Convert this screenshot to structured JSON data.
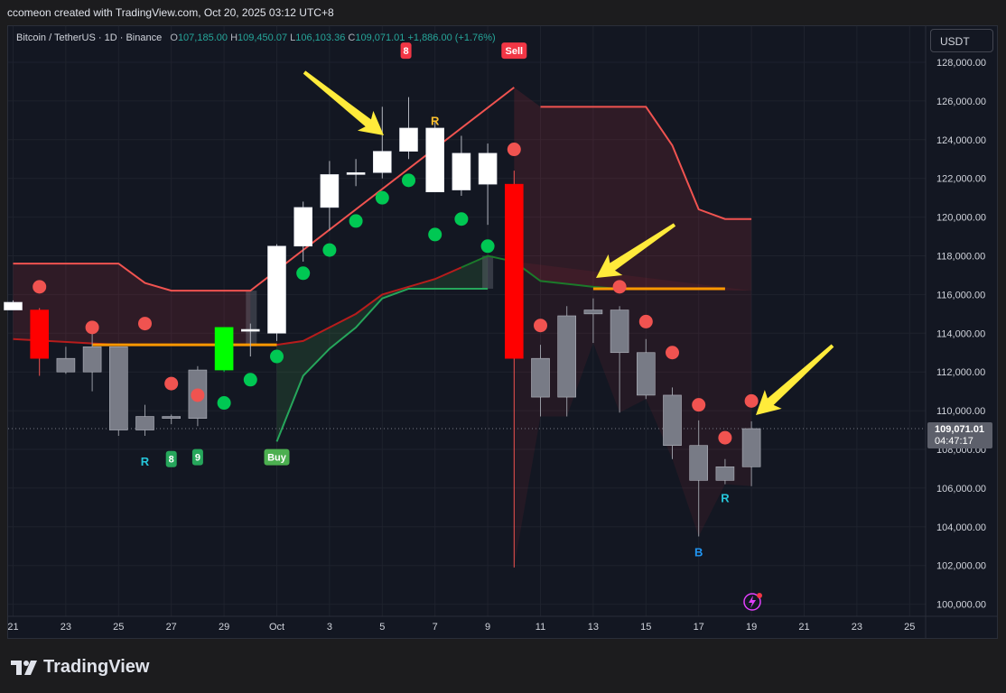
{
  "header": {
    "snapshot_text": "ccomeon created with TradingView.com, Oct 20, 2025 03:12 UTC+8"
  },
  "legend": {
    "symbol": "Bitcoin / TetherUS · 1D · Binance",
    "open_label": "O",
    "open": "107,185.00",
    "high_label": "H",
    "high": "109,450.07",
    "low_label": "L",
    "low": "106,103.36",
    "close_label": "C",
    "close": "109,071.01",
    "change": "+1,886.00 (+1.76%)"
  },
  "currency_button": "USDT",
  "footer": {
    "brand": "TradingView"
  },
  "colors": {
    "background": "#131722",
    "grid": "#1e222d",
    "bull_body": "#ffffff",
    "bear_body_red": "#ff0000",
    "bear_body_gray": "#787b86",
    "buy_green": "#00ff00",
    "sell_label": "#f23645",
    "buy_label": "#4caf50",
    "dot_red": "#f05350",
    "dot_green": "#00c853",
    "arrow": "#ffeb3b"
  },
  "chart_data": {
    "type": "candlestick",
    "y_axis": {
      "range": [
        99500,
        129000
      ],
      "ticks": [
        "100,000.00",
        "102,000.00",
        "104,000.00",
        "106,000.00",
        "108,000.00",
        "110,000.00",
        "112,000.00",
        "114,000.00",
        "116,000.00",
        "118,000.00",
        "120,000.00",
        "122,000.00",
        "124,000.00",
        "126,000.00",
        "128,000.00"
      ],
      "tick_values": [
        100000,
        102000,
        104000,
        106000,
        108000,
        110000,
        112000,
        114000,
        116000,
        118000,
        120000,
        122000,
        124000,
        126000,
        128000
      ]
    },
    "x_axis": {
      "labels": [
        "21",
        "23",
        "25",
        "27",
        "29",
        "Oct",
        "3",
        "5",
        "7",
        "9",
        "11",
        "13",
        "15",
        "17",
        "19",
        "21",
        "23",
        "25"
      ],
      "label_day_index": [
        0,
        2,
        4,
        6,
        8,
        10,
        12,
        14,
        16,
        18,
        20,
        22,
        24,
        26,
        28,
        30,
        32,
        34
      ]
    },
    "candles": [
      {
        "d": 0,
        "o": 115600,
        "h": 115700,
        "l": 115200,
        "c": 115200,
        "style": "bull"
      },
      {
        "d": 1,
        "o": 115200,
        "h": 115300,
        "l": 111800,
        "c": 112700,
        "style": "red"
      },
      {
        "d": 2,
        "o": 112700,
        "h": 113300,
        "l": 111900,
        "c": 112000,
        "style": "gray"
      },
      {
        "d": 3,
        "o": 112000,
        "h": 114000,
        "l": 111000,
        "c": 113300,
        "style": "gray"
      },
      {
        "d": 4,
        "o": 113300,
        "h": 113300,
        "l": 108700,
        "c": 109000,
        "style": "gray"
      },
      {
        "d": 5,
        "o": 109700,
        "h": 110300,
        "l": 108700,
        "c": 109000,
        "style": "gray"
      },
      {
        "d": 6,
        "o": 109700,
        "h": 109800,
        "l": 109300,
        "c": 109600,
        "style": "gray"
      },
      {
        "d": 7,
        "o": 109600,
        "h": 112300,
        "l": 109200,
        "c": 112100,
        "style": "gray"
      },
      {
        "d": 8,
        "o": 112100,
        "h": 114300,
        "l": 112000,
        "c": 114300,
        "style": "green"
      },
      {
        "d": 9,
        "o": 114100,
        "h": 114500,
        "l": 112800,
        "c": 114200,
        "style": "bull"
      },
      {
        "d": 10,
        "o": 114000,
        "h": 118600,
        "l": 113600,
        "c": 118500,
        "style": "bull"
      },
      {
        "d": 11,
        "o": 118500,
        "h": 120800,
        "l": 117700,
        "c": 120500,
        "style": "bull"
      },
      {
        "d": 12,
        "o": 120500,
        "h": 122900,
        "l": 119300,
        "c": 122200,
        "style": "bull"
      },
      {
        "d": 13,
        "o": 122200,
        "h": 123000,
        "l": 121600,
        "c": 122300,
        "style": "bull"
      },
      {
        "d": 14,
        "o": 122300,
        "h": 125700,
        "l": 122000,
        "c": 123400,
        "style": "bull"
      },
      {
        "d": 15,
        "o": 123400,
        "h": 126200,
        "l": 123000,
        "c": 124600,
        "style": "bull"
      },
      {
        "d": 16,
        "o": 124600,
        "h": 125000,
        "l": 121300,
        "c": 121300,
        "style": "bull"
      },
      {
        "d": 17,
        "o": 121400,
        "h": 124200,
        "l": 121100,
        "c": 123300,
        "style": "bull"
      },
      {
        "d": 18,
        "o": 123300,
        "h": 123800,
        "l": 119600,
        "c": 121700,
        "style": "bull"
      },
      {
        "d": 19,
        "o": 121700,
        "h": 122400,
        "l": 101900,
        "c": 112700,
        "style": "red"
      },
      {
        "d": 20,
        "o": 110700,
        "h": 113400,
        "l": 109700,
        "c": 112700,
        "style": "gray"
      },
      {
        "d": 21,
        "o": 110700,
        "h": 115400,
        "l": 109700,
        "c": 114900,
        "style": "gray"
      },
      {
        "d": 22,
        "o": 115000,
        "h": 115800,
        "l": 113500,
        "c": 115200,
        "style": "gray"
      },
      {
        "d": 23,
        "o": 115200,
        "h": 115400,
        "l": 109900,
        "c": 113000,
        "style": "gray"
      },
      {
        "d": 24,
        "o": 113000,
        "h": 113700,
        "l": 110600,
        "c": 110800,
        "style": "gray"
      },
      {
        "d": 25,
        "o": 110800,
        "h": 111200,
        "l": 107500,
        "c": 108200,
        "style": "gray"
      },
      {
        "d": 26,
        "o": 108200,
        "h": 109500,
        "l": 103500,
        "c": 106400,
        "style": "gray"
      },
      {
        "d": 27,
        "o": 106400,
        "h": 107500,
        "l": 106200,
        "c": 107100,
        "style": "gray"
      },
      {
        "d": 28,
        "o": 107100,
        "h": 109450,
        "l": 106100,
        "c": 109071,
        "style": "gray"
      }
    ],
    "dots": [
      {
        "d": 1,
        "v": 116400,
        "c": "red"
      },
      {
        "d": 3,
        "v": 114300,
        "c": "red"
      },
      {
        "d": 5,
        "v": 114500,
        "c": "red"
      },
      {
        "d": 6,
        "v": 111400,
        "c": "red"
      },
      {
        "d": 7,
        "v": 110800,
        "c": "red"
      },
      {
        "d": 8,
        "v": 110400,
        "c": "green"
      },
      {
        "d": 9,
        "v": 111600,
        "c": "green"
      },
      {
        "d": 10,
        "v": 112800,
        "c": "green"
      },
      {
        "d": 11,
        "v": 117100,
        "c": "green"
      },
      {
        "d": 12,
        "v": 118300,
        "c": "green"
      },
      {
        "d": 13,
        "v": 119800,
        "c": "green"
      },
      {
        "d": 14,
        "v": 121000,
        "c": "green"
      },
      {
        "d": 15,
        "v": 121900,
        "c": "green"
      },
      {
        "d": 16,
        "v": 119100,
        "c": "green"
      },
      {
        "d": 17,
        "v": 119900,
        "c": "green"
      },
      {
        "d": 18,
        "v": 118500,
        "c": "green"
      },
      {
        "d": 19,
        "v": 123500,
        "c": "red"
      },
      {
        "d": 20,
        "v": 114400,
        "c": "red"
      },
      {
        "d": 23,
        "v": 116400,
        "c": "red"
      },
      {
        "d": 24,
        "v": 114600,
        "c": "red"
      },
      {
        "d": 25,
        "v": 113000,
        "c": "red"
      },
      {
        "d": 26,
        "v": 110300,
        "c": "red"
      },
      {
        "d": 27,
        "v": 108600,
        "c": "red"
      },
      {
        "d": 28,
        "v": 110500,
        "c": "red"
      }
    ],
    "upper_band": [
      [
        0,
        117600
      ],
      [
        4,
        117600
      ],
      [
        5,
        116600
      ],
      [
        6,
        116200
      ],
      [
        9,
        116200
      ],
      [
        19,
        126700
      ],
      [
        20,
        125700
      ],
      [
        24,
        125700
      ],
      [
        25,
        123700
      ],
      [
        26,
        120400
      ],
      [
        27,
        119900
      ],
      [
        28,
        119900
      ]
    ],
    "lower_band": [
      [
        10,
        108400
      ],
      [
        11,
        111800
      ],
      [
        12,
        113200
      ],
      [
        13,
        114300
      ],
      [
        14,
        115800
      ],
      [
        15,
        116300
      ],
      [
        18,
        116300
      ]
    ],
    "baseline_red": [
      [
        0,
        113700
      ],
      [
        4,
        113400
      ],
      [
        9,
        113400
      ],
      [
        10,
        113400
      ],
      [
        11,
        113600
      ],
      [
        12,
        114300
      ],
      [
        13,
        115000
      ],
      [
        14,
        116000
      ],
      [
        15,
        116400
      ],
      [
        16,
        116800
      ],
      [
        17,
        117400
      ],
      [
        18,
        118000
      ],
      [
        19,
        117700
      ],
      [
        20,
        116700
      ],
      [
        22,
        116400
      ],
      [
        23,
        116300
      ],
      [
        28,
        116200
      ]
    ],
    "orange_line_1": [
      [
        3,
        113400
      ],
      [
        10,
        113400
      ]
    ],
    "orange_line_2": [
      [
        22,
        116300
      ],
      [
        27,
        116300
      ]
    ],
    "price_labels": [
      {
        "d": 14.9,
        "v": 128600,
        "text": "8",
        "kind": "red-tag"
      },
      {
        "d": 19,
        "v": 128600,
        "text": "Sell",
        "kind": "red-tag"
      },
      {
        "d": 16,
        "v": 125000,
        "text": "R",
        "kind": "yellow-text"
      },
      {
        "d": 5,
        "v": 107400,
        "text": "R",
        "kind": "teal-text"
      },
      {
        "d": 6,
        "v": 107500,
        "text": "8",
        "kind": "green-tag"
      },
      {
        "d": 7,
        "v": 107600,
        "text": "9",
        "kind": "green-tag"
      },
      {
        "d": 10,
        "v": 107600,
        "text": "Buy",
        "kind": "buy-tag"
      },
      {
        "d": 26,
        "v": 102700,
        "text": "B",
        "kind": "blue-text"
      },
      {
        "d": 27,
        "v": 105500,
        "text": "R",
        "kind": "teal-text"
      }
    ],
    "current_price": {
      "value": 109071.01,
      "label": "109,071.01",
      "countdown": "04:47:17"
    }
  }
}
